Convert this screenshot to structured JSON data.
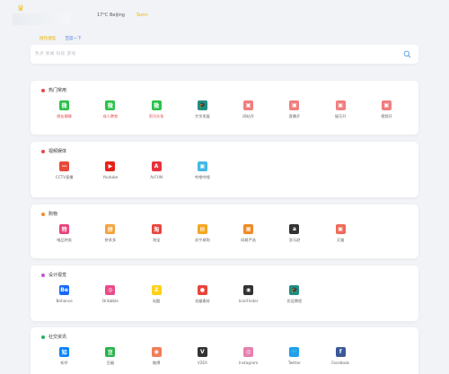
{
  "header": {
    "weather": "17°C Beijing",
    "weather_extra": "Sunn"
  },
  "search": {
    "tabs": [
      "搜热搜型",
      "百度一下"
    ],
    "placeholder": "热点  新闻  科技  游戏"
  },
  "sections": [
    {
      "title": "热门常用",
      "dot_color": "#e24a4a",
      "sites": [
        {
          "label": "朋友圈聊",
          "icon": "wechat-icon",
          "color": "#2bc24b",
          "glyph": "微",
          "hl": true
        },
        {
          "label": "成人教育",
          "icon": "wechat-icon",
          "color": "#2bc24b",
          "glyph": "微",
          "hl": true
        },
        {
          "label": "资讯头条",
          "icon": "wechat-icon",
          "color": "#2bc24b",
          "glyph": "微",
          "hl": true
        },
        {
          "label": "大学发展",
          "icon": "graduation-cap-icon",
          "color": "#1e8f82",
          "glyph": "🎓",
          "hl": false
        },
        {
          "label": "网站开",
          "icon": "tv-icon",
          "color": "#f07e7e",
          "glyph": "▣",
          "hl": false
        },
        {
          "label": "直播开",
          "icon": "tv-icon",
          "color": "#f07e7e",
          "glyph": "▣",
          "hl": false
        },
        {
          "label": "娱乐开",
          "icon": "tv-icon",
          "color": "#f07e7e",
          "glyph": "▣",
          "hl": false
        },
        {
          "label": "视频开",
          "icon": "tv-icon",
          "color": "#f07e7e",
          "glyph": "▣",
          "hl": false
        }
      ]
    },
    {
      "title": "视频娱体",
      "dot_color": "#e24a4a",
      "sites": [
        {
          "label": "CCTV直播",
          "icon": "cctv-icon",
          "color": "#e84a3c",
          "glyph": "—",
          "hl": false
        },
        {
          "label": "Youtube",
          "icon": "youtube-icon",
          "color": "#e62117",
          "glyph": "▶",
          "hl": false
        },
        {
          "label": "AcFUN",
          "icon": "acfun-icon",
          "color": "#e8323c",
          "glyph": "A",
          "hl": false
        },
        {
          "label": "哔哩哔哩",
          "icon": "bilibili-icon",
          "color": "#43b8e6",
          "glyph": "▣",
          "hl": false
        }
      ]
    },
    {
      "title": "购物",
      "dot_color": "#f08a24",
      "sites": [
        {
          "label": "唯品特卖",
          "icon": "special-sale-icon",
          "color": "#e8457a",
          "glyph": "特",
          "hl": false
        },
        {
          "label": "拼多多",
          "icon": "pinduoduo-icon",
          "color": "#f3a23a",
          "glyph": "拼",
          "hl": false
        },
        {
          "label": "淘宝",
          "icon": "taobao-icon",
          "color": "#e8453c",
          "glyph": "淘",
          "hl": false
        },
        {
          "label": "苏宁易购",
          "icon": "suning-icon",
          "color": "#f5a623",
          "glyph": "▤",
          "hl": false
        },
        {
          "label": "网易严选",
          "icon": "yanxuan-icon",
          "color": "#f08a24",
          "glyph": "▦",
          "hl": false
        },
        {
          "label": "亚马逊",
          "icon": "amazon-icon",
          "color": "#333333",
          "glyph": "a",
          "hl": false
        },
        {
          "label": "天猫",
          "icon": "tmall-icon",
          "color": "#ee6a5a",
          "glyph": "▣",
          "hl": false
        }
      ]
    },
    {
      "title": "设计视觉",
      "dot_color": "#c552d6",
      "sites": [
        {
          "label": "Behance",
          "icon": "behance-icon",
          "color": "#1769ff",
          "glyph": "Be",
          "hl": false
        },
        {
          "label": "Dribbble",
          "icon": "dribbble-icon",
          "color": "#ea4c89",
          "glyph": "◎",
          "hl": false
        },
        {
          "label": "站酷",
          "icon": "zcool-icon",
          "color": "#ffd11a",
          "glyph": "Z",
          "hl": false
        },
        {
          "label": "花瓣素材",
          "icon": "huaban-icon",
          "color": "#e8453c",
          "glyph": "●",
          "hl": false
        },
        {
          "label": "IconFinder",
          "icon": "eye-icon",
          "color": "#333333",
          "glyph": "◉",
          "hl": false
        },
        {
          "label": "优设教程",
          "icon": "graduation-cap-icon",
          "color": "#1e8f82",
          "glyph": "🎓",
          "hl": false
        }
      ]
    },
    {
      "title": "社交资讯",
      "dot_color": "#22b35c",
      "sites": [
        {
          "label": "知乎",
          "icon": "zhihu-icon",
          "color": "#0a84ff",
          "glyph": "知",
          "hl": false
        },
        {
          "label": "豆瓣",
          "icon": "douban-icon",
          "color": "#2bb24c",
          "glyph": "豆",
          "hl": false
        },
        {
          "label": "微博",
          "icon": "weibo-icon",
          "color": "#f07e5a",
          "glyph": "◉",
          "hl": false
        },
        {
          "label": "V2EX",
          "icon": "v2ex-icon",
          "color": "#333333",
          "glyph": "V",
          "hl": false
        },
        {
          "label": "Instagram",
          "icon": "instagram-icon",
          "color": "#e87fb0",
          "glyph": "◎",
          "hl": false
        },
        {
          "label": "Twitter",
          "icon": "twitter-icon",
          "color": "#1da1f2",
          "glyph": "🐦",
          "hl": false
        },
        {
          "label": "Facebook",
          "icon": "facebook-icon",
          "color": "#3b5998",
          "glyph": "f",
          "hl": false
        }
      ]
    }
  ]
}
